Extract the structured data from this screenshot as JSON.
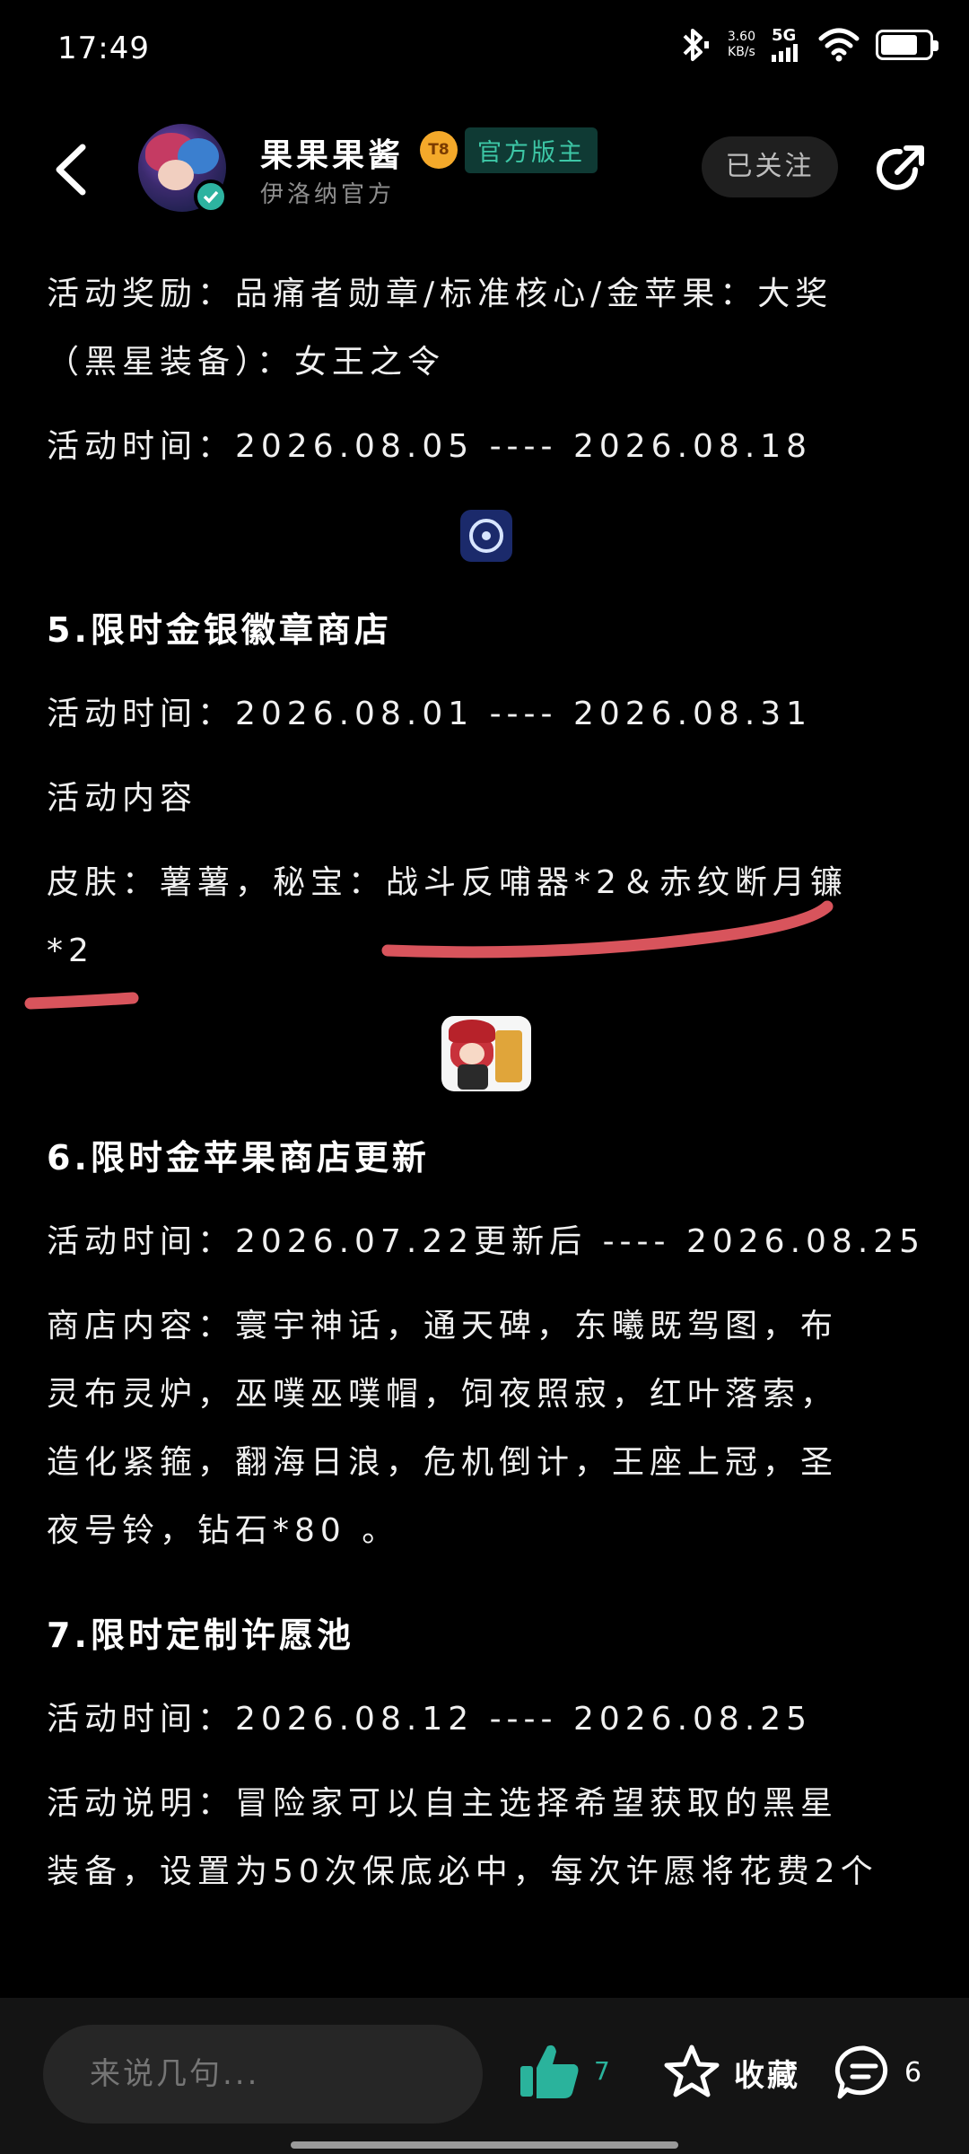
{
  "status_bar": {
    "time": "17:49",
    "speed_value": "3.60",
    "speed_unit": "KB/s",
    "network": "5G"
  },
  "header": {
    "author_name": "果果果酱",
    "level_badge": "T8",
    "role_tag": "官方版主",
    "author_sub": "伊洛纳官方",
    "follow_label": "已关注"
  },
  "content": {
    "reward_line1": "活动奖励：品痛者勋章/标准核心/金苹果：大奖",
    "reward_line2": "（黑星装备）：女王之令",
    "time_a": "活动时间：2026.08.05 ---- 2026.08.18",
    "sec5_title": "5.限时金银徽章商店",
    "sec5_time": "活动时间：2026.08.01 ---- 2026.08.31",
    "sec5_content_label": "活动内容",
    "sec5_content_line1": "皮肤：薯薯，秘宝：战斗反哺器*2＆赤纹断月镰",
    "sec5_content_line2": "*2",
    "sec6_title": "6.限时金苹果商店更新",
    "sec6_time": "活动时间：2026.07.22更新后 ---- 2026.08.25",
    "sec6_line1": "商店内容：寰宇神话，通天碑，东曦既驾图，布",
    "sec6_line2": "灵布灵炉，巫噗巫噗帽，饲夜照寂，红叶落索，",
    "sec6_line3": "造化紧箍，翻海日浪，危机倒计，王座上冠，圣",
    "sec6_line4": "夜号铃，钻石*80 。",
    "sec7_title": "7.限时定制许愿池",
    "sec7_time": "活动时间：2026.08.12 ---- 2026.08.25",
    "sec7_desc1": "活动说明：冒险家可以自主选择希望获取的黑星",
    "sec7_desc2": "装备，设置为50次保底必中，每次许愿将花费2个"
  },
  "bottom_bar": {
    "comment_placeholder": "来说几句...",
    "like_count": "7",
    "favorite_label": "收藏",
    "comment_count": "6"
  },
  "colors": {
    "background": "#000000",
    "accent_teal": "#2ab39c",
    "underline_red": "#d8545c",
    "bottom_bar": "#141414"
  },
  "icons": [
    "bluetooth-icon",
    "wifi-icon",
    "battery-icon",
    "back-arrow-icon",
    "verified-icon",
    "share-icon",
    "thumbs-up-icon",
    "star-icon",
    "comment-icon"
  ]
}
